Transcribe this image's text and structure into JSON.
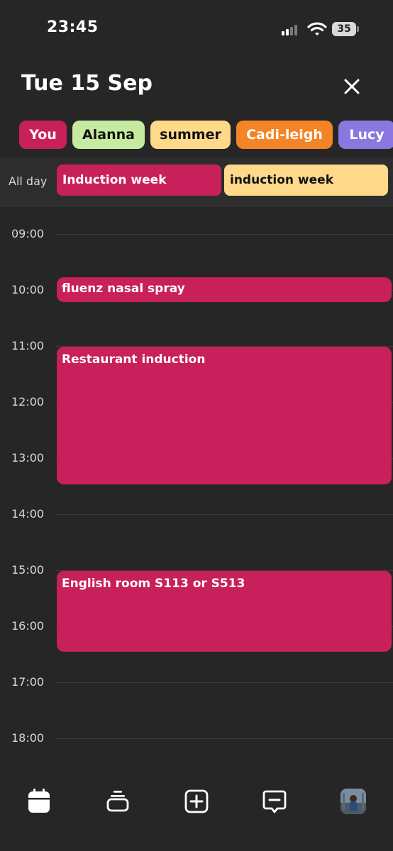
{
  "status": {
    "time": "23:45",
    "battery": "35"
  },
  "header": {
    "date": "Tue 15 Sep"
  },
  "chips": [
    {
      "label": "You",
      "bg": "#c8205a",
      "fg": "#ffffff"
    },
    {
      "label": "Alanna",
      "bg": "#c5eaa0",
      "fg": "#111111"
    },
    {
      "label": "summer",
      "bg": "#ffd98a",
      "fg": "#111111"
    },
    {
      "label": "Cadi-leigh",
      "bg": "#f58427",
      "fg": "#ffffff"
    },
    {
      "label": "Lucy",
      "bg": "#8a78e0",
      "fg": "#ffffff"
    }
  ],
  "all_day": {
    "label": "All day",
    "events": [
      {
        "title": "Induction week",
        "color": "#c8205a"
      },
      {
        "title": "induction week",
        "color": "#ffd98a"
      }
    ]
  },
  "hours": [
    "09:00",
    "10:00",
    "11:00",
    "12:00",
    "13:00",
    "14:00",
    "15:00",
    "16:00",
    "17:00",
    "18:00"
  ],
  "events": [
    {
      "title": "fluenz nasal spray",
      "color": "#c8205a"
    },
    {
      "title": "Restaurant induction",
      "color": "#c8205a"
    },
    {
      "title": "English room S113 or S513",
      "color": "#c8205a"
    }
  ],
  "nav": {
    "icons": [
      "calendar-icon",
      "stack-icon",
      "add-icon",
      "message-icon",
      "profile-avatar"
    ]
  }
}
